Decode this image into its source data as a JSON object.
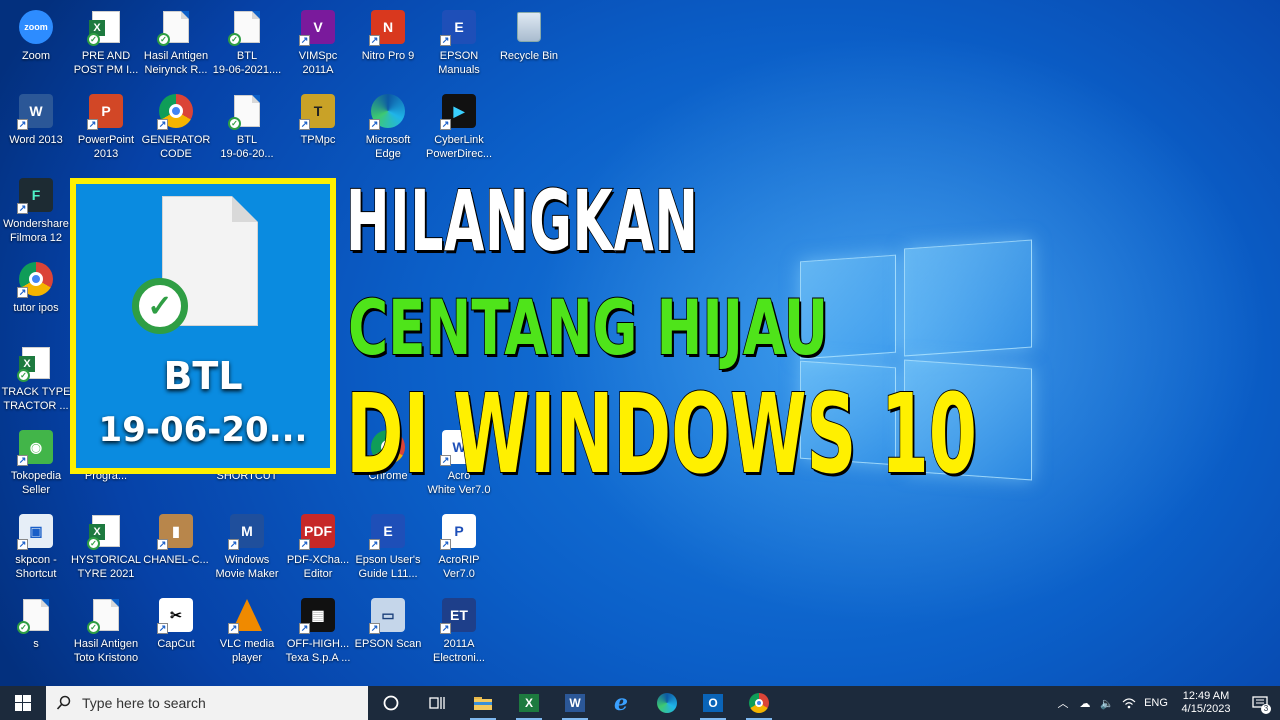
{
  "desktop": {
    "icons": [
      {
        "label": "Zoom",
        "icon": "zoom-icon"
      },
      {
        "label": "PRE AND\nPOST PM I...",
        "icon": "excel-file-icon"
      },
      {
        "label": "Hasil Antigen\nNeirynck R...",
        "icon": "document-icon"
      },
      {
        "label": "BTL\n19-06-2021....",
        "icon": "document-icon"
      },
      {
        "label": "VIMSpc\n2011A",
        "icon": "vimspc-icon"
      },
      {
        "label": "Nitro Pro 9",
        "icon": "nitro-pdf-icon"
      },
      {
        "label": "EPSON\nManuals",
        "icon": "epson-manuals-icon"
      },
      {
        "label": "Recycle Bin",
        "icon": "recycle-bin-icon"
      },
      {
        "label": "Word 2013",
        "icon": "word-icon"
      },
      {
        "label": "PowerPoint\n2013",
        "icon": "powerpoint-icon"
      },
      {
        "label": "GENERATOR\nCODE",
        "icon": "chrome-icon"
      },
      {
        "label": "BTL\n19-06-20...",
        "icon": "document-icon"
      },
      {
        "label": "TPMpc",
        "icon": "tpmpc-icon"
      },
      {
        "label": "Microsoft\nEdge",
        "icon": "edge-icon"
      },
      {
        "label": "CyberLink\nPowerDirec...",
        "icon": "powerdirector-icon"
      },
      {
        "label": "Wondershare\nFilmora 12",
        "icon": "filmora-icon"
      },
      {
        "label": "tutor ipos",
        "icon": "chrome-icon"
      },
      {
        "label": "TRACK TYPE\nTRACTOR ...",
        "icon": "excel-file-icon"
      },
      {
        "label": "Tokopedia\nSeller",
        "icon": "tokopedia-icon"
      },
      {
        "label": "Progra...",
        "icon": "program-icon"
      },
      {
        "label": "SHORTCUT",
        "icon": "shortcut-icon"
      },
      {
        "label": "Chrome",
        "icon": "chrome-icon"
      },
      {
        "label": "Acro\nWhite Ver7.0",
        "icon": "acrorip-white-icon"
      },
      {
        "label": "skpcon -\nShortcut",
        "icon": "skpcon-icon"
      },
      {
        "label": "HYSTORICAL\nTYRE 2021",
        "icon": "excel-file-icon"
      },
      {
        "label": "CHANEL-C...",
        "icon": "archive-icon"
      },
      {
        "label": "Windows\nMovie Maker",
        "icon": "movie-maker-icon"
      },
      {
        "label": "PDF-XCha...\nEditor",
        "icon": "pdf-xchange-icon"
      },
      {
        "label": "Epson User's\nGuide L11...",
        "icon": "epson-guide-icon"
      },
      {
        "label": "AcroRIP\nVer7.0",
        "icon": "acrorip-icon"
      },
      {
        "label": "s",
        "icon": "document-icon"
      },
      {
        "label": "Hasil Antigen\nToto Kristono",
        "icon": "document-icon"
      },
      {
        "label": "CapCut",
        "icon": "capcut-icon"
      },
      {
        "label": "VLC media\nplayer",
        "icon": "vlc-icon"
      },
      {
        "label": "OFF-HIGH...\nTexa S.p.A ...",
        "icon": "texa-icon"
      },
      {
        "label": "EPSON Scan",
        "icon": "epson-scan-icon"
      },
      {
        "label": "2011A\nElectroni...",
        "icon": "electronic-icon"
      }
    ]
  },
  "zoom": {
    "label_line1": "BTL",
    "label_line2": "19-06-20..."
  },
  "headline": {
    "line1": "HILANGKAN",
    "line2": "CENTANG HIJAU",
    "line3": "DI WINDOWS 10",
    "colors": {
      "line1": "#ffffff",
      "line2": "#4fe41a",
      "line3": "#fff000"
    }
  },
  "taskbar": {
    "search_placeholder": "Type here to search",
    "apps": [
      "task-view",
      "file-explorer",
      "excel",
      "word",
      "internet-explorer",
      "edge",
      "outlook",
      "chrome"
    ],
    "tray": {
      "language": "ENG",
      "time": "12:49 AM",
      "date": "4/15/2023",
      "notification_count": "3"
    }
  },
  "colors": {
    "highlight_border": "#fff000",
    "check_green": "#2f9e44",
    "taskbar_bg": "#1c2a3c"
  }
}
